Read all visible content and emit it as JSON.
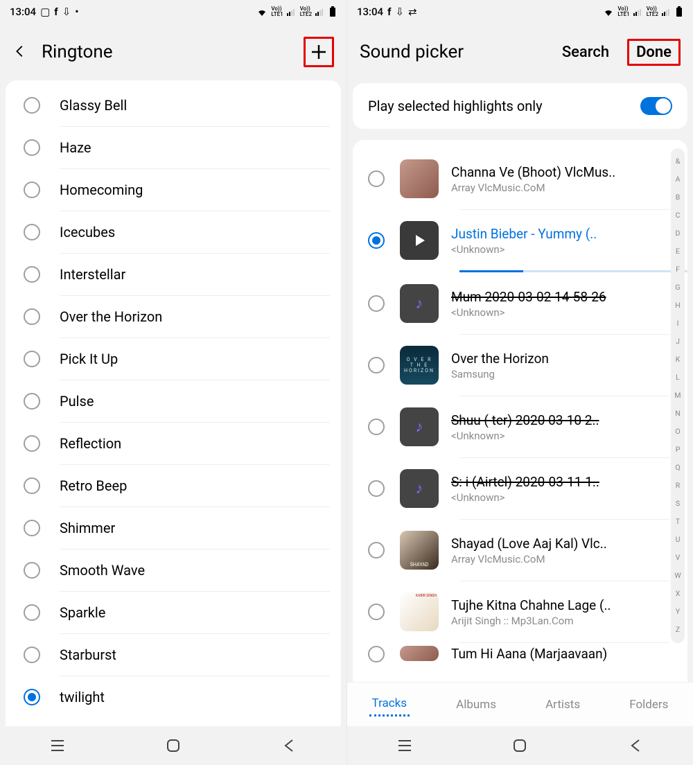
{
  "left": {
    "status_time": "13:04",
    "header_title": "Ringtone",
    "ringtones": [
      {
        "name": "Glassy Bell",
        "selected": false
      },
      {
        "name": "Haze",
        "selected": false
      },
      {
        "name": "Homecoming",
        "selected": false
      },
      {
        "name": "Icecubes",
        "selected": false
      },
      {
        "name": "Interstellar",
        "selected": false
      },
      {
        "name": "Over the Horizon",
        "selected": false
      },
      {
        "name": "Pick It Up",
        "selected": false
      },
      {
        "name": "Pulse",
        "selected": false
      },
      {
        "name": "Reflection",
        "selected": false
      },
      {
        "name": "Retro Beep",
        "selected": false
      },
      {
        "name": "Shimmer",
        "selected": false
      },
      {
        "name": "Smooth Wave",
        "selected": false
      },
      {
        "name": "Sparkle",
        "selected": false
      },
      {
        "name": "Starburst",
        "selected": false
      },
      {
        "name": "twilight",
        "selected": true
      }
    ]
  },
  "right": {
    "status_time": "13:04",
    "header_title": "Sound picker",
    "search_label": "Search",
    "done_label": "Done",
    "highlights_label": "Play selected highlights only",
    "tracks": [
      {
        "title": "Channa Ve (Bhoot) VlcMus..",
        "artist": "Array VlcMusic.CoM",
        "selected": false,
        "playing": false,
        "thumb": "album1",
        "strike": false
      },
      {
        "title": "Justin Bieber - Yummy (..",
        "artist": "<Unknown>",
        "selected": true,
        "playing": true,
        "thumb": "play",
        "strike": false
      },
      {
        "title": "Mum 2020-03-02 14-58-26",
        "artist": "<Unknown>",
        "selected": false,
        "playing": false,
        "thumb": "note",
        "strike": true
      },
      {
        "title": "Over the Horizon",
        "artist": "Samsung",
        "selected": false,
        "playing": false,
        "thumb": "album-oth",
        "strike": false
      },
      {
        "title": "Shuu (     ter) 2020 03-10 2..",
        "artist": "<Unknown>",
        "selected": false,
        "playing": false,
        "thumb": "note",
        "strike": true
      },
      {
        "title": "S:    i (Airtel) 2020-03-11 1..",
        "artist": "<Unknown>",
        "selected": false,
        "playing": false,
        "thumb": "note",
        "strike": true
      },
      {
        "title": "Shayad (Love Aaj Kal) Vlc..",
        "artist": "Array VlcMusic.CoM",
        "selected": false,
        "playing": false,
        "thumb": "album-shayad",
        "strike": false
      },
      {
        "title": "Tujhe Kitna Chahne Lage (..",
        "artist": "Arijit Singh :: Mp3Lan.Com",
        "selected": false,
        "playing": false,
        "thumb": "album-kabir",
        "strike": false
      },
      {
        "title": "Tum Hi Aana (Marjaavaan)",
        "artist": "",
        "selected": false,
        "playing": false,
        "thumb": "album1",
        "strike": false,
        "partial": true
      }
    ],
    "tabs": [
      {
        "label": "Tracks",
        "active": true
      },
      {
        "label": "Albums",
        "active": false
      },
      {
        "label": "Artists",
        "active": false
      },
      {
        "label": "Folders",
        "active": false
      }
    ],
    "index_letters": [
      "&",
      "A",
      "B",
      "C",
      "D",
      "E",
      "F",
      "G",
      "H",
      "I",
      "J",
      "K",
      "L",
      "M",
      "N",
      "O",
      "P",
      "Q",
      "R",
      "S",
      "T",
      "U",
      "V",
      "W",
      "X",
      "Y",
      "Z"
    ]
  }
}
